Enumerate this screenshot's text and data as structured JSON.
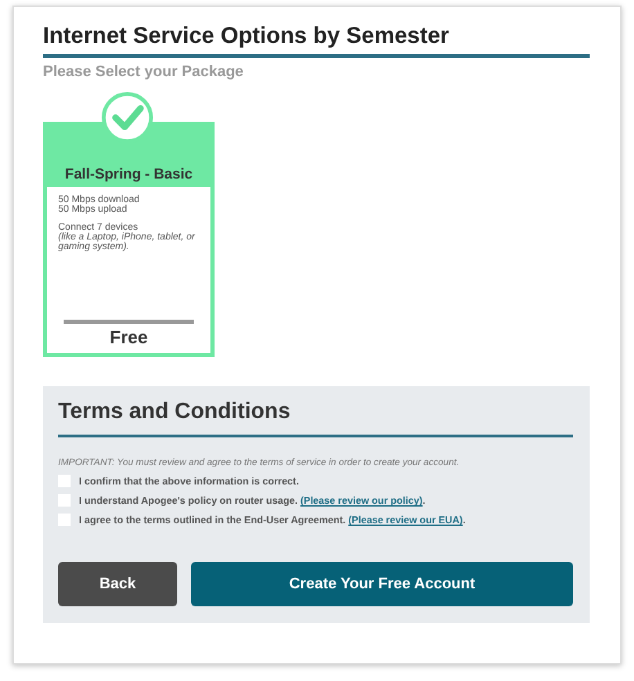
{
  "title": "Internet Service Options by Semester",
  "subtitle": "Please Select your Package",
  "packages": [
    {
      "name": "Fall-Spring - Basic",
      "selected": true,
      "speeds": [
        "50 Mbps download",
        "50 Mbps upload"
      ],
      "devices": "Connect 7 devices",
      "devices_note": "(like a Laptop, iPhone, tablet, or gaming system).",
      "price": "Free"
    }
  ],
  "terms": {
    "title": "Terms and Conditions",
    "notice": "IMPORTANT: You must review and agree to the terms of service in order to create your account.",
    "items": [
      {
        "text": "I confirm that the above information is correct.",
        "checked": false
      },
      {
        "text": "I understand Apogee's policy on router usage.",
        "link": "(Please review our policy)",
        "after": ".",
        "checked": false
      },
      {
        "text": "I agree to the terms outlined in the End-User Agreement.",
        "link": "(Please review our EUA)",
        "after": ".",
        "checked": false
      }
    ]
  },
  "buttons": [
    {
      "kind": "secondary",
      "label": "Back"
    },
    {
      "kind": "primary",
      "label": "Create Your Free Account"
    }
  ]
}
